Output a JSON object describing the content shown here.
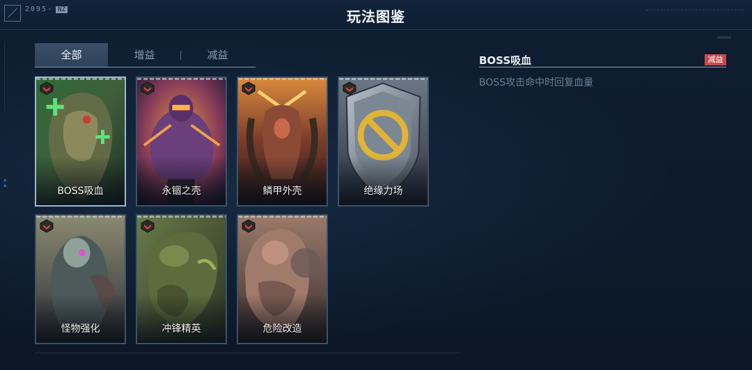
{
  "header": {
    "logo_text": "2095-",
    "logo_tag": "NZ",
    "title": "玩法图鉴"
  },
  "tabs": [
    {
      "label": "全部",
      "active": true
    },
    {
      "label": "增益",
      "active": false
    },
    {
      "label": "减益",
      "active": false
    }
  ],
  "cards": [
    {
      "label": "BOSS吸血",
      "selected": true,
      "icon": "boss-lifesteal-art"
    },
    {
      "label": "永锢之壳",
      "selected": false,
      "icon": "eternal-shell-art"
    },
    {
      "label": "鳞甲外壳",
      "selected": false,
      "icon": "scale-armor-art"
    },
    {
      "label": "绝缘力场",
      "selected": false,
      "icon": "insulation-field-shield-art"
    },
    {
      "label": "怪物强化",
      "selected": false,
      "icon": "monster-enhance-art"
    },
    {
      "label": "冲锋精英",
      "selected": false,
      "icon": "charge-elite-art"
    },
    {
      "label": "危险改造",
      "selected": false,
      "icon": "dangerous-modification-art"
    }
  ],
  "detail": {
    "title": "BOSS吸血",
    "badge": "减益",
    "description": "BOSS攻击命中时回复血量"
  },
  "colors": {
    "background": "#0d1a2b",
    "accent_badge": "#c64b4e",
    "tab_active": "#3a4f68"
  }
}
